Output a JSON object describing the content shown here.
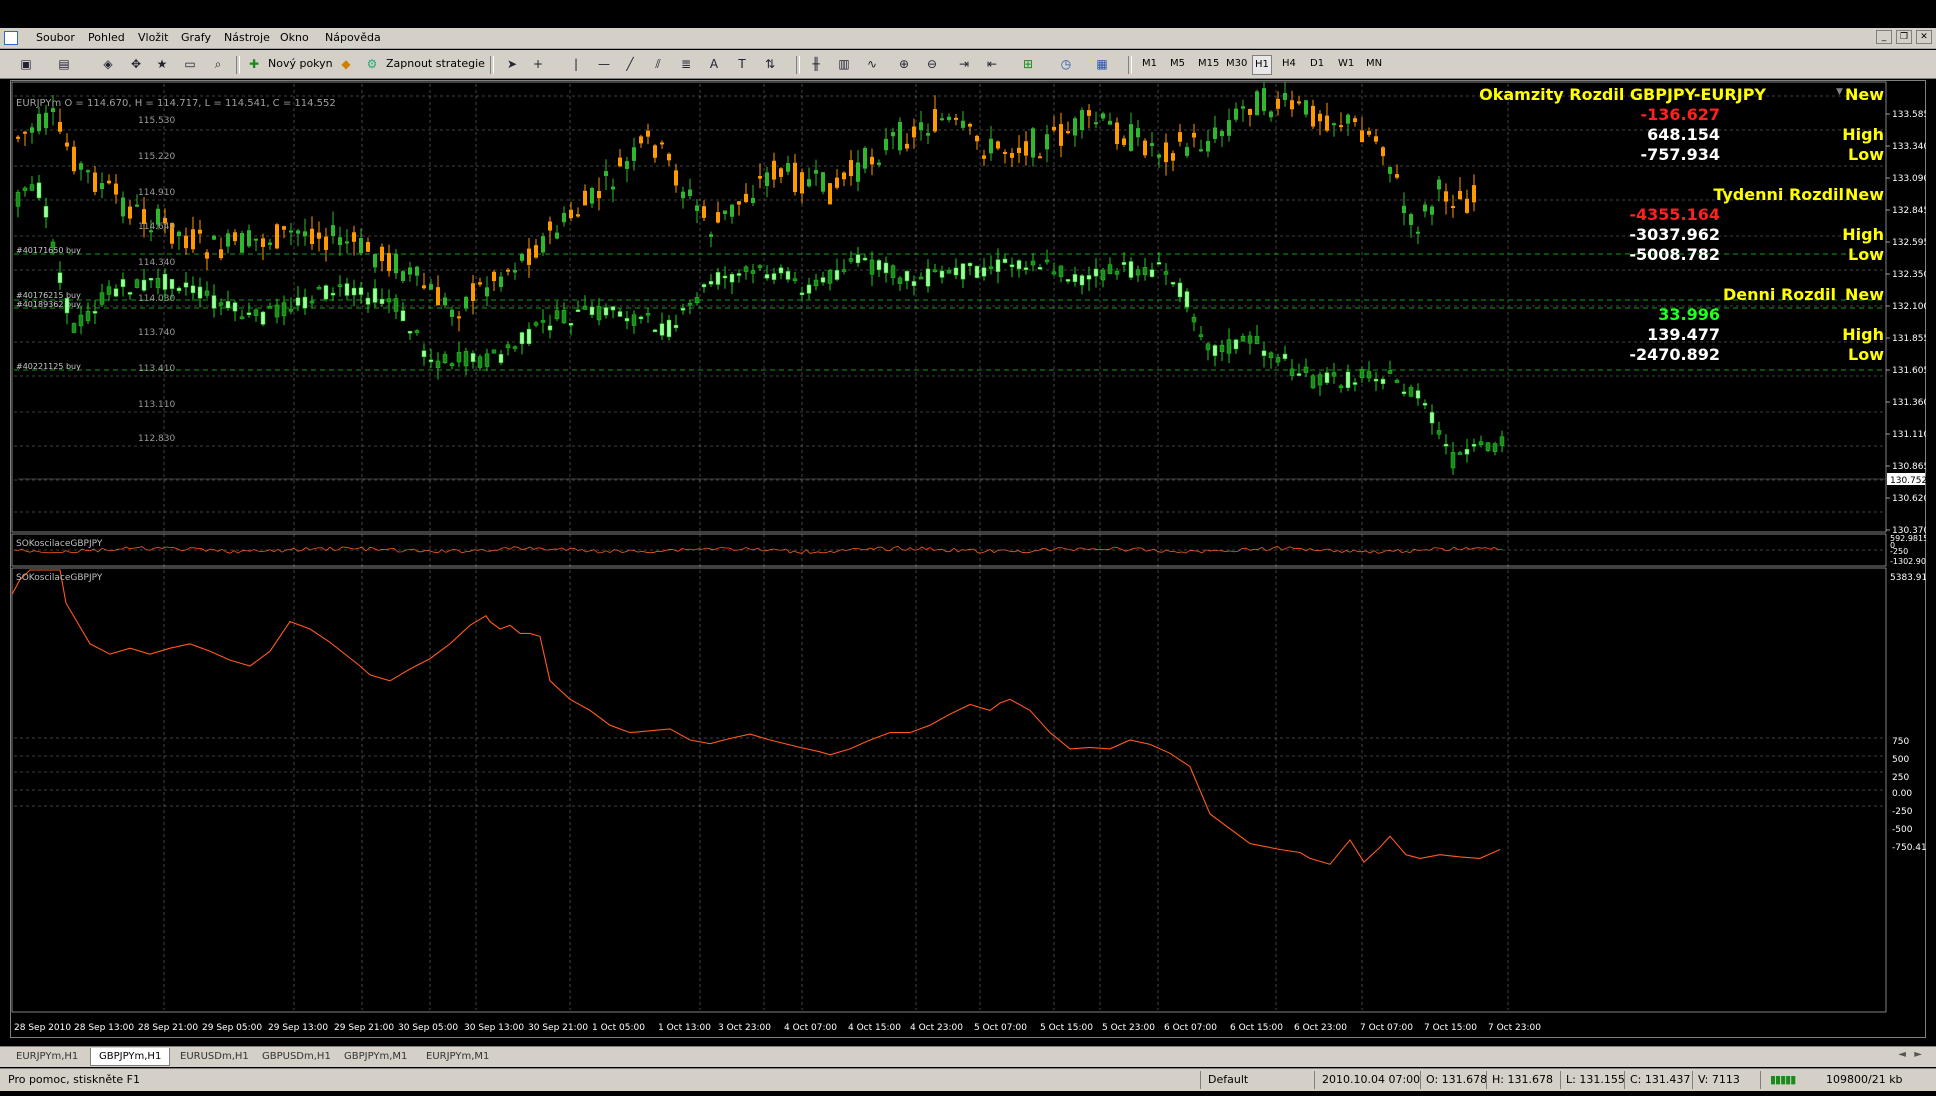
{
  "menu": {
    "items": [
      "Soubor",
      "Pohled",
      "Vložit",
      "Grafy",
      "Nástroje",
      "Okno",
      "Nápověda"
    ]
  },
  "toolbar": {
    "new_order_label": "Nový pokyn",
    "strategy_label": "Zapnout strategie",
    "timeframes": [
      "M1",
      "M5",
      "M15",
      "M30",
      "H1",
      "H4",
      "D1",
      "W1",
      "MN"
    ],
    "active_timeframe": "H1"
  },
  "chart": {
    "info_line": "EURJPYm O = 114.670, H = 114.717, L = 114.541, C = 114.552",
    "left_scale": [
      "115.530",
      "115.220",
      "114.910",
      "114.640",
      "114.340",
      "114.030",
      "113.740",
      "113.410",
      "113.110",
      "112.830"
    ],
    "right_scale": [
      "133.585",
      "133.340",
      "133.090",
      "132.845",
      "132.595",
      "132.350",
      "132.100",
      "131.855",
      "131.605",
      "131.360",
      "131.110",
      "130.865",
      "130.620",
      "130.370"
    ],
    "current_price": "130.752",
    "order_labels": [
      "#40171650 buy",
      "#40176215 buy",
      "#40189362 buy",
      "#40221125 buy"
    ],
    "overlay": {
      "okamzity_title": "Okamzity Rozdil GBPJPY-EURJPY",
      "okamzity_new": "New",
      "okamzity_value": "-136.627",
      "okamzity_high": "648.154",
      "okamzity_low": "-757.934",
      "tydenni_title": "Tydenni Rozdil",
      "tydenni_new": "New",
      "tydenni_value": "-4355.164",
      "tydenni_high": "-3037.962",
      "tydenni_low": "-5008.782",
      "denni_title": "Denni Rozdil",
      "denni_new": "New",
      "denni_value": "33.996",
      "denni_high": "139.477",
      "denni_low": "-2470.892",
      "high_label": "High",
      "low_label": "Low"
    },
    "indicator1": {
      "name": "SOKoscilaceGBPJPY",
      "scale": [
        "592.9815",
        "0",
        "-250",
        "-1302.90"
      ]
    },
    "indicator2": {
      "name": "SOKoscilaceGBPJPY",
      "top_value": "5383.914",
      "scale": [
        "750",
        "500",
        "250",
        "0.00",
        "-250",
        "-500",
        "-750.419"
      ]
    },
    "time_labels": [
      "28 Sep 2010",
      "28 Sep 13:00",
      "28 Sep 21:00",
      "29 Sep 05:00",
      "29 Sep 13:00",
      "29 Sep 21:00",
      "30 Sep 05:00",
      "30 Sep 13:00",
      "30 Sep 21:00",
      "1 Oct 05:00",
      "1 Oct 13:00",
      "3 Oct 23:00",
      "4 Oct 07:00",
      "4 Oct 15:00",
      "4 Oct 23:00",
      "5 Oct 07:00",
      "5 Oct 15:00",
      "5 Oct 23:00",
      "6 Oct 07:00",
      "6 Oct 15:00",
      "6 Oct 23:00",
      "7 Oct 07:00",
      "7 Oct 15:00",
      "7 Oct 23:00"
    ]
  },
  "tabs": [
    "EURJPYm,H1",
    "GBPJPYm,H1",
    "EURUSDm,H1",
    "GBPUSDm,H1",
    "GBPJPYm,M1",
    "EURJPYm,M1"
  ],
  "active_tab": "GBPJPYm,H1",
  "status": {
    "help": "Pro pomoc, stiskněte F1",
    "profile": "Default",
    "datetime": "2010.10.04 07:00",
    "open": "O: 131.678",
    "high": "H: 131.678",
    "low": "L: 131.155",
    "close": "C: 131.437",
    "volume": "V: 7113",
    "traffic": "109800/21 kb"
  },
  "colors": {
    "bull": "#2eb82e",
    "bear": "#ff9900",
    "line1": "#22cc22",
    "osc": "#ff5a1a",
    "overlay_title": "#ffff00",
    "value_red": "#ff2020",
    "value_green": "#22ff22"
  }
}
